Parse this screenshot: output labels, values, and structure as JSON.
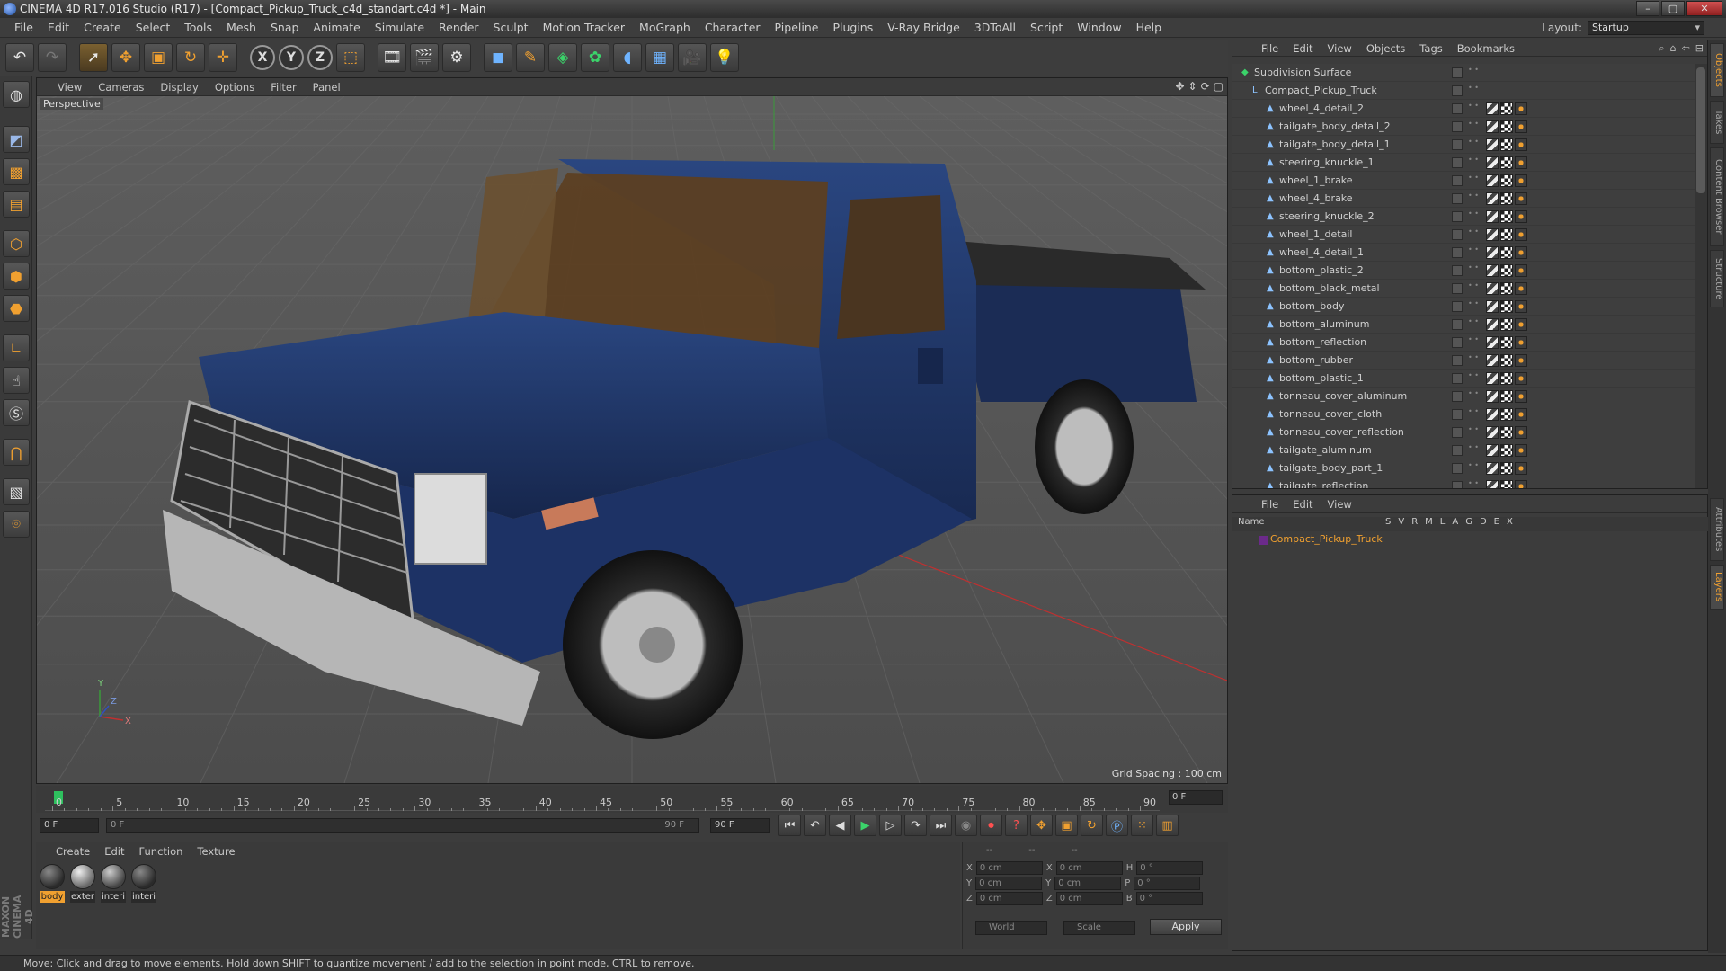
{
  "window": {
    "title": "CINEMA 4D R17.016 Studio (R17) - [Compact_Pickup_Truck_c4d_standart.c4d *] - Main",
    "buttons": {
      "minimize": "–",
      "maximize": "▢",
      "close": "✕"
    }
  },
  "menubar": {
    "items": [
      "File",
      "Edit",
      "Create",
      "Select",
      "Tools",
      "Mesh",
      "Snap",
      "Animate",
      "Simulate",
      "Render",
      "Sculpt",
      "Motion Tracker",
      "MoGraph",
      "Character",
      "Pipeline",
      "Plugins",
      "V-Ray Bridge",
      "3DToAll",
      "Script",
      "Window",
      "Help"
    ],
    "layout_label": "Layout:",
    "layout_value": "Startup"
  },
  "toolbar": {
    "icons": [
      "undo-icon",
      "redo-icon",
      "select-icon",
      "move-icon",
      "scale-icon",
      "rotate-icon",
      "live-select-icon",
      "x-axis-icon",
      "y-axis-icon",
      "z-axis-icon",
      "coordinate-system-icon",
      "render-view-icon",
      "render-picture-viewer-icon",
      "edit-render-settings-icon",
      "cube-icon",
      "pen-icon",
      "subdivision-icon",
      "array-icon",
      "deformer-icon",
      "floor-icon",
      "camera-icon",
      "light-icon"
    ],
    "x_label": "X",
    "y_label": "Y",
    "z_label": "Z"
  },
  "lefttools": {
    "icons": [
      "make-editable-icon",
      "model-icon",
      "texture-icon",
      "workplane-icon",
      "points-icon",
      "edges-icon",
      "polygons-icon",
      "axis-icon",
      "tweak-icon",
      "snap-icon",
      "magnet-icon",
      "soft-select-icon",
      "lock-icon"
    ]
  },
  "branding": {
    "text": "MAXON CINEMA 4D"
  },
  "viewport": {
    "menu": [
      "View",
      "Cameras",
      "Display",
      "Options",
      "Filter",
      "Panel"
    ],
    "label": "Perspective",
    "grid_spacing": "Grid Spacing : 100 cm",
    "axis_labels": {
      "y": "Y",
      "x": "X",
      "z": "Z"
    }
  },
  "timeline": {
    "ticks": [
      "0",
      "5",
      "10",
      "15",
      "20",
      "25",
      "30",
      "35",
      "40",
      "45",
      "50",
      "55",
      "60",
      "65",
      "70",
      "75",
      "80",
      "85",
      "90"
    ],
    "current_frame": "0 F",
    "start_field": "0 F",
    "slider_start": "0 F",
    "slider_end": "90 F",
    "end_field": "90 F"
  },
  "materials": {
    "menu": [
      "Create",
      "Edit",
      "Function",
      "Texture"
    ],
    "items": [
      {
        "label": "body",
        "selected": true
      },
      {
        "label": "exter",
        "selected": false
      },
      {
        "label": "interi",
        "selected": false
      },
      {
        "label": "interi",
        "selected": false
      }
    ]
  },
  "coordinates": {
    "headers": [
      "--",
      "--",
      "--"
    ],
    "rows": [
      {
        "a": "X",
        "av": "0 cm",
        "b": "X",
        "bv": "0 cm",
        "c": "H",
        "cv": "0 °"
      },
      {
        "a": "Y",
        "av": "0 cm",
        "b": "Y",
        "bv": "0 cm",
        "c": "P",
        "cv": "0 °"
      },
      {
        "a": "Z",
        "av": "0 cm",
        "b": "Z",
        "bv": "0 cm",
        "c": "B",
        "cv": "0 °"
      }
    ],
    "world": "World",
    "scale": "Scale",
    "apply": "Apply"
  },
  "object_manager": {
    "menu": [
      "File",
      "Edit",
      "View",
      "Objects",
      "Tags",
      "Bookmarks"
    ],
    "objects": [
      {
        "name": "Subdivision Surface",
        "indent": 0
      },
      {
        "name": "Compact_Pickup_Truck",
        "indent": 1
      },
      {
        "name": "wheel_4_detail_2",
        "indent": 2
      },
      {
        "name": "tailgate_body_detail_2",
        "indent": 2
      },
      {
        "name": "tailgate_body_detail_1",
        "indent": 2
      },
      {
        "name": "steering_knuckle_1",
        "indent": 2
      },
      {
        "name": "wheel_1_brake",
        "indent": 2
      },
      {
        "name": "wheel_4_brake",
        "indent": 2
      },
      {
        "name": "steering_knuckle_2",
        "indent": 2
      },
      {
        "name": "wheel_1_detail",
        "indent": 2
      },
      {
        "name": "wheel_4_detail_1",
        "indent": 2
      },
      {
        "name": "bottom_plastic_2",
        "indent": 2
      },
      {
        "name": "bottom_black_metal",
        "indent": 2
      },
      {
        "name": "bottom_body",
        "indent": 2
      },
      {
        "name": "bottom_aluminum",
        "indent": 2
      },
      {
        "name": "bottom_reflection",
        "indent": 2
      },
      {
        "name": "bottom_rubber",
        "indent": 2
      },
      {
        "name": "bottom_plastic_1",
        "indent": 2
      },
      {
        "name": "tonneau_cover_aluminum",
        "indent": 2
      },
      {
        "name": "tonneau_cover_cloth",
        "indent": 2
      },
      {
        "name": "tonneau_cover_reflection",
        "indent": 2
      },
      {
        "name": "tailgate_aluminum",
        "indent": 2
      },
      {
        "name": "tailgate_body_part_1",
        "indent": 2
      },
      {
        "name": "tailgate_reflection",
        "indent": 2
      }
    ]
  },
  "layer_manager": {
    "menu": [
      "File",
      "Edit",
      "View"
    ],
    "columns": [
      "Name",
      "S",
      "V",
      "R",
      "M",
      "L",
      "A",
      "G",
      "D",
      "E",
      "X"
    ],
    "layer": "Compact_Pickup_Truck"
  },
  "right_tabs": [
    "Objects",
    "Takes",
    "Content Browser",
    "Structure",
    "Attributes",
    "Layers"
  ],
  "status": {
    "text": "Move: Click and drag to move elements. Hold down SHIFT to quantize movement / add to the selection in point mode, CTRL to remove."
  },
  "colors": {
    "accent": "#f0a030",
    "truck_body": "#1f3566",
    "playhead": "#2ec05e"
  }
}
